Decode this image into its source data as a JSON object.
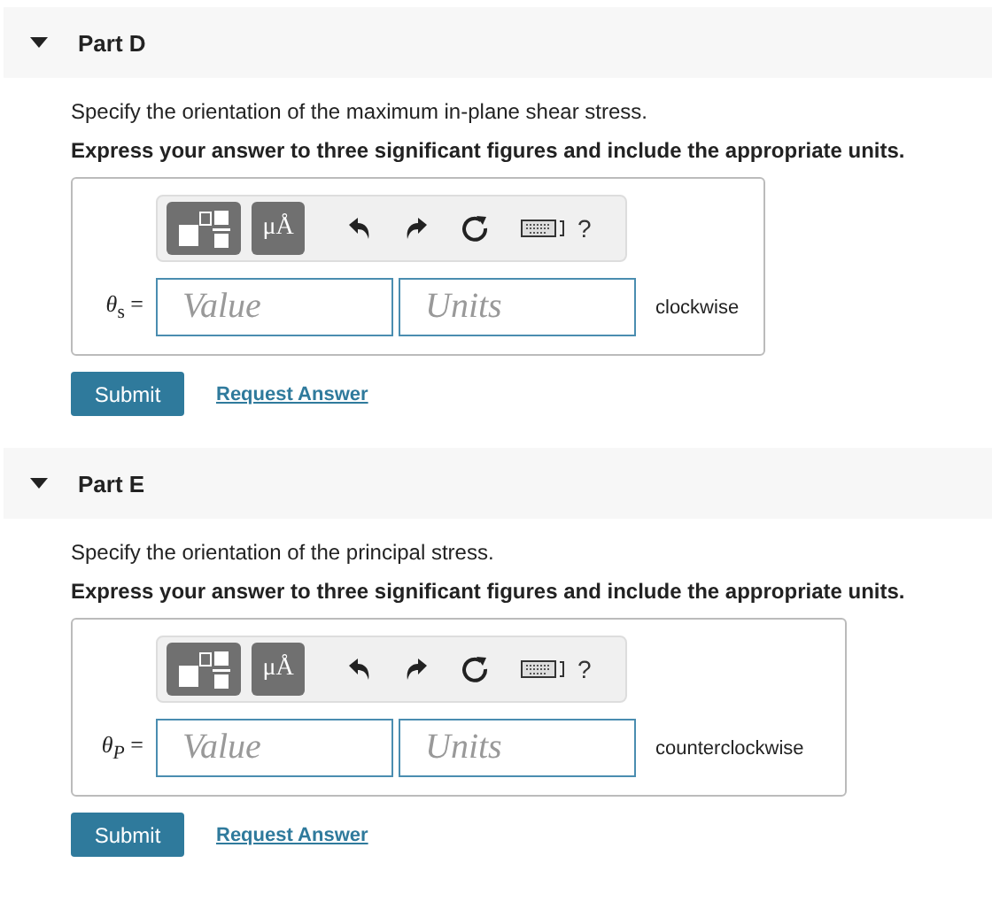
{
  "parts": [
    {
      "title": "Part D",
      "expanded": true,
      "question": "Specify the orientation of the maximum in-plane shear stress.",
      "instruction": "Express your answer to three significant figures and include the appropriate units.",
      "toolbar": {
        "units_button": "μÅ",
        "help": "?"
      },
      "label": "*θ*$_{s}$ =",
      "value_placeholder": "Value",
      "units_placeholder": "Units",
      "suffix": "clockwise",
      "submit": "Submit",
      "request": "Request Answer"
    },
    {
      "title": "Part E",
      "expanded": true,
      "question": "Specify the orientation of the principal stress.",
      "instruction": "Express your answer to three significant figures and include the appropriate units.",
      "toolbar": {
        "units_button": "μÅ",
        "help": "?"
      },
      "label": "*θ$_{P}$* =",
      "value_placeholder": "Value",
      "units_placeholder": "Units",
      "suffix": "counterclockwise",
      "submit": "Submit",
      "request": "Request Answer"
    }
  ]
}
